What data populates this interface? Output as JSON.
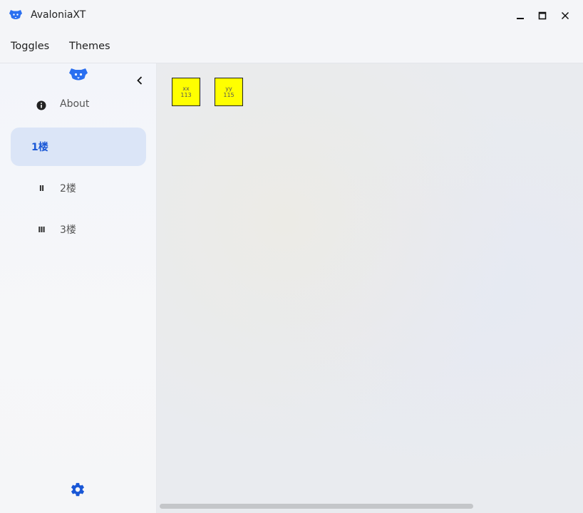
{
  "window": {
    "title": "AvaloniaXT",
    "logo_icon": "dog-logo-icon",
    "controls": [
      "minimize-icon",
      "maximize-icon",
      "close-icon"
    ]
  },
  "menu": {
    "items": [
      {
        "label": "Toggles"
      },
      {
        "label": "Themes"
      }
    ]
  },
  "sidebar": {
    "logo_icon": "dog-logo-icon",
    "collapse_icon": "chevron-left-icon",
    "items": [
      {
        "icon": "info-icon",
        "label": "About",
        "selected": false
      },
      {
        "icon": "",
        "label": "1楼",
        "selected": true
      },
      {
        "icon": "Ⅱ",
        "label": "2楼",
        "selected": false
      },
      {
        "icon": "Ⅲ",
        "label": "3楼",
        "selected": false
      }
    ],
    "settings_icon": "gear-icon"
  },
  "content": {
    "tiles": [
      {
        "top": "xx",
        "bottom": "113"
      },
      {
        "top": "yy",
        "bottom": "115"
      }
    ]
  },
  "colors": {
    "accent": "#1957d6",
    "selected_bg": "#dbe5f7",
    "tile_bg": "#ffff00"
  }
}
